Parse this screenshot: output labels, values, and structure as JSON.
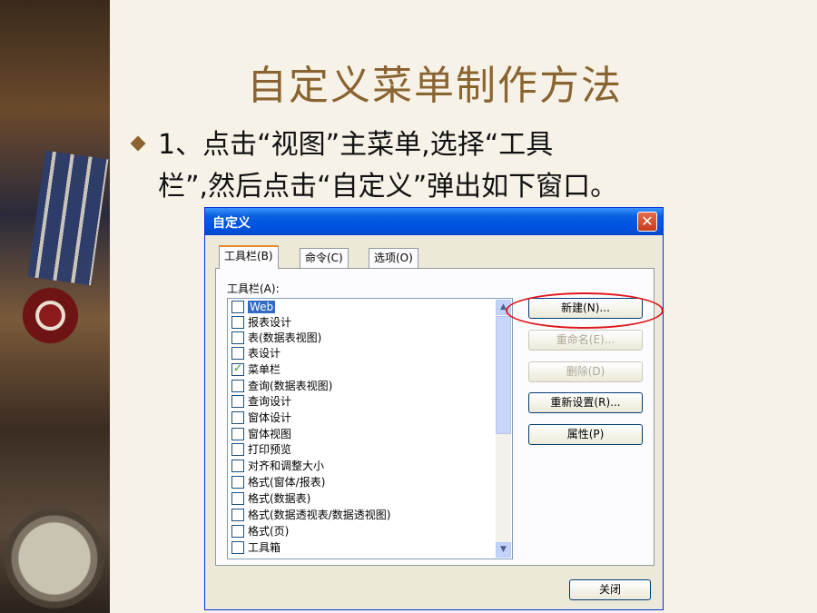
{
  "slide": {
    "title": "自定义菜单制作方法",
    "bullet_line1": "1、点击“视图”主菜单,选择“工具",
    "bullet_line2": "栏”,然后点击“自定义”弹出如下窗口。"
  },
  "dialog": {
    "title": "自定义",
    "tabs": [
      "工具栏(B)",
      "命令(C)",
      "选项(O)"
    ],
    "active_tab": "工具栏(B)",
    "list_label": "工具栏(A):",
    "toolbars": [
      {
        "label": "Web",
        "checked": false,
        "selected": true
      },
      {
        "label": "报表设计",
        "checked": false
      },
      {
        "label": "表(数据表视图)",
        "checked": false
      },
      {
        "label": "表设计",
        "checked": false
      },
      {
        "label": "菜单栏",
        "checked": true
      },
      {
        "label": "查询(数据表视图)",
        "checked": false
      },
      {
        "label": "查询设计",
        "checked": false
      },
      {
        "label": "窗体设计",
        "checked": false
      },
      {
        "label": "窗体视图",
        "checked": false
      },
      {
        "label": "打印预览",
        "checked": false
      },
      {
        "label": "对齐和调整大小",
        "checked": false
      },
      {
        "label": "格式(窗体/报表)",
        "checked": false
      },
      {
        "label": "格式(数据表)",
        "checked": false
      },
      {
        "label": "格式(数据透视表/数据透视图)",
        "checked": false
      },
      {
        "label": "格式(页)",
        "checked": false
      },
      {
        "label": "工具箱",
        "checked": false
      }
    ],
    "buttons": {
      "new": "新建(N)...",
      "rename": "重命名(E)...",
      "delete": "删除(D)",
      "reset": "重新设置(R)...",
      "properties": "属性(P)",
      "close": "关闭"
    },
    "close_glyph": "✕",
    "highlight_color": "#e0161a"
  }
}
